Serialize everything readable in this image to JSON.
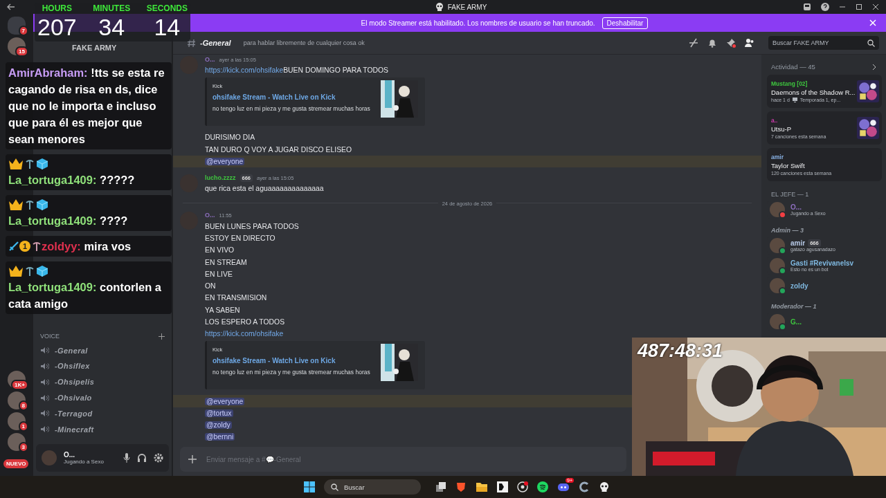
{
  "window": {
    "title": "FAKE ARMY"
  },
  "banner": {
    "text": "El modo Streamer está habilitado. Los nombres de usuario se han truncado.",
    "button": "Deshabilitar"
  },
  "servers": [
    {
      "kind": "home",
      "badge": "7"
    },
    {
      "kind": "server",
      "badge": "15"
    },
    {
      "kind": "server",
      "badge": "1K+"
    },
    {
      "kind": "server",
      "badge": "8"
    },
    {
      "kind": "server",
      "badge": "1"
    },
    {
      "kind": "server",
      "badge": "3"
    },
    {
      "kind": "new",
      "badge": "NUEVO"
    }
  ],
  "server_header": {
    "name": "FAKE ARMY"
  },
  "voice": {
    "label": "VOICE",
    "channels": [
      "-General",
      "-Ohsiflex",
      "-Ohsipelis",
      "-Ohsivalo",
      "-Terragod",
      "-Minecraft"
    ]
  },
  "user_panel": {
    "name": "O...",
    "status": "Jugando a Sexo"
  },
  "channel_header": {
    "name": "-General",
    "topic": "para hablar libremente de cualquier cosa ok"
  },
  "member_search": {
    "placeholder": "Buscar FAKE ARMY"
  },
  "messages": [
    {
      "kind": "message",
      "author": "O...",
      "color": "#8e6fc0",
      "time": "ayer a las 15:05",
      "lines": [
        {
          "kind": "link",
          "link": "https://kick.com/ohsifake",
          "text": " BUEN DOMINGO PARA TODOS"
        },
        {
          "kind": "embed",
          "provider": "Kick",
          "title": "ohsifake Stream - Watch Live on Kick",
          "description": "no tengo luz en mi pieza y me gusta stremear muchas horas"
        },
        {
          "kind": "text",
          "text": "DURISIMO DIA"
        },
        {
          "kind": "text",
          "text": "TAN DURO Q VOY A JUGAR DISCO ELISEO"
        },
        {
          "kind": "mention",
          "text": "@everyone",
          "highlighted": true
        }
      ]
    },
    {
      "kind": "message",
      "author": "lucho.zzzz",
      "color": "#3ec53e",
      "badge": "666",
      "time": "ayer a las 15:05",
      "lines": [
        {
          "kind": "text",
          "text": "que rica esta el aguaaaaaaaaaaaaaa"
        }
      ]
    },
    {
      "kind": "divider",
      "text": "24 de agosto de 2026"
    },
    {
      "kind": "message",
      "author": "O...",
      "color": "#8e6fc0",
      "time": "11:55",
      "lines": [
        {
          "kind": "text",
          "text": "BUEN LUNES PARA TODOS"
        },
        {
          "kind": "text",
          "text": "ESTOY EN DIRECTO"
        },
        {
          "kind": "text",
          "text": "EN VIVO"
        },
        {
          "kind": "text",
          "text": "EN STREAM"
        },
        {
          "kind": "text",
          "text": "EN LIVE"
        },
        {
          "kind": "text",
          "text": "ON"
        },
        {
          "kind": "text",
          "text": "EN TRANSMISION"
        },
        {
          "kind": "text",
          "text": "YA SABEN"
        },
        {
          "kind": "text",
          "text": "LOS ESPERO A TODOS"
        },
        {
          "kind": "link",
          "link": "https://kick.com/ohsifake"
        },
        {
          "kind": "embed",
          "provider": "Kick",
          "title": "ohsifake Stream - Watch Live on Kick",
          "description": "no tengo luz en mi pieza y me gusta stremear muchas horas"
        },
        {
          "kind": "mention",
          "text": "@everyone",
          "highlighted": true
        },
        {
          "kind": "mention",
          "text": "@tortux",
          "highlighted": false
        },
        {
          "kind": "mention",
          "text": "@zoldy",
          "highlighted": false
        },
        {
          "kind": "mention",
          "text": "@bernni",
          "highlighted": false
        }
      ]
    }
  ],
  "composer": {
    "placeholder": "Enviar mensaje a #💬-General"
  },
  "activity": {
    "title": "Actividad — 45",
    "cards": [
      {
        "kind": "art",
        "user": "Mustang [02]",
        "color": "#3ec53e",
        "title": "Daemons of the Shadow R...",
        "detail": "hace 1 d",
        "detail_2": "Temporada 1, ep..."
      },
      {
        "kind": "art",
        "user": "a..",
        "color": "#d03bb0",
        "title": "Utsu-P",
        "detail": "7 canciones esta semana"
      },
      {
        "kind": "plain",
        "user": "amir",
        "color": "#8ab4e8",
        "title": "Taylor Swift",
        "detail": "120 canciones esta semana"
      }
    ]
  },
  "member_groups": [
    {
      "title": "EL JEFE — 1",
      "members": [
        {
          "name": "O...",
          "color": "#8e6fc0",
          "status": "Jugando a Sexo",
          "online": false
        }
      ]
    },
    {
      "title": "Admin — 3",
      "members": [
        {
          "name": "amir",
          "color": "#b7c9e6",
          "badge": "666",
          "status": "gatazo agusanadazo",
          "online": true
        },
        {
          "name": "Gasti #Revivanelsv",
          "color": "#7fb8e0",
          "status": "Esto no es un bot",
          "online": true
        },
        {
          "name": "zoldy",
          "color": "#7fb8e0",
          "online": true
        }
      ]
    },
    {
      "title": "Moderador — 1",
      "members": [
        {
          "name": "G...",
          "color": "#3ec53e",
          "online": true
        }
      ]
    }
  ],
  "taskbar": {
    "search": "Buscar",
    "discord_badge": "9+"
  },
  "timer": {
    "units": [
      {
        "label": "HOURS",
        "value": "207"
      },
      {
        "label": "MINUTES",
        "value": "34"
      },
      {
        "label": "SECONDS",
        "value": "14"
      }
    ]
  },
  "stream_chat": [
    {
      "kind": "plain",
      "user": "AmirAbraham:",
      "color": "#c79cf5",
      "text": "!tts se esta re cagando de risa en ds, dice que no le importa e incluso que para él es mejor que sean menores"
    },
    {
      "kind": "badged",
      "user": "La_tortuga1409:",
      "color": "#8fe07a",
      "text": "?????"
    },
    {
      "kind": "badged",
      "user": "La_tortuga1409:",
      "color": "#8fe07a",
      "text": "????"
    },
    {
      "kind": "inline",
      "user": "zoldyy:",
      "color": "#e0304e",
      "badge": "1",
      "text": "mira vos"
    },
    {
      "kind": "badged",
      "user": "La_tortuga1409:",
      "color": "#8fe07a",
      "text": "contorlen a cata amigo"
    }
  ],
  "webcam": {
    "clock": "487:48:31"
  }
}
